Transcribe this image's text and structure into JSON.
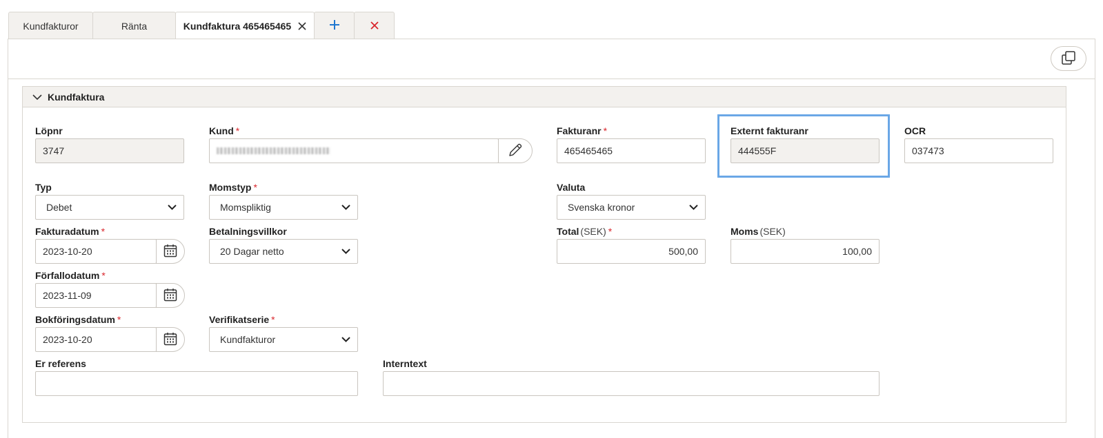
{
  "tabs": [
    {
      "label": "Kundfakturor"
    },
    {
      "label": "Ränta"
    },
    {
      "label": "Kundfaktura 465465465"
    }
  ],
  "section": {
    "title": "Kundfaktura"
  },
  "fields": {
    "lopnr": {
      "label": "Löpnr",
      "value": "3747"
    },
    "kund": {
      "label": "Kund",
      "required": "*"
    },
    "fakturanr": {
      "label": "Fakturanr",
      "required": "*",
      "value": "465465465"
    },
    "externt": {
      "label": "Externt fakturanr",
      "value": "444555F"
    },
    "ocr": {
      "label": "OCR",
      "value": "037473"
    },
    "typ": {
      "label": "Typ",
      "value": "Debet"
    },
    "momstyp": {
      "label": "Momstyp",
      "required": "*",
      "value": "Momspliktig"
    },
    "valuta": {
      "label": "Valuta",
      "value": "Svenska kronor"
    },
    "fakturadatum": {
      "label": "Fakturadatum",
      "required": "*",
      "value": "2023-10-20"
    },
    "betalningsvillkor": {
      "label": "Betalningsvillkor",
      "value": "20 Dagar netto"
    },
    "total": {
      "label": "Total",
      "unit": "(SEK)",
      "required": "*",
      "value": "500,00"
    },
    "moms": {
      "label": "Moms",
      "unit": "(SEK)",
      "value": "100,00"
    },
    "forfallodatum": {
      "label": "Förfallodatum",
      "required": "*",
      "value": "2023-11-09"
    },
    "bokforingsdatum": {
      "label": "Bokföringsdatum",
      "required": "*",
      "value": "2023-10-20"
    },
    "verifikatserie": {
      "label": "Verifikatserie",
      "required": "*",
      "value": "Kundfakturor"
    },
    "er_referens": {
      "label": "Er referens",
      "value": ""
    },
    "interntext": {
      "label": "Interntext",
      "value": ""
    }
  },
  "icons": {
    "close_tab": "close-icon",
    "add_tab": "plus-icon",
    "close_all": "close-red-icon",
    "copy": "copy-icon",
    "collapse": "chevron-down-icon",
    "edit": "pencil-icon",
    "calendar": "calendar-icon",
    "dropdown": "chevron-down-icon"
  },
  "colors": {
    "accent_blue": "#1f77d0",
    "danger_red": "#d9262c",
    "highlight": "#6aa7e6",
    "readonly_bg": "#f3f1ee"
  }
}
